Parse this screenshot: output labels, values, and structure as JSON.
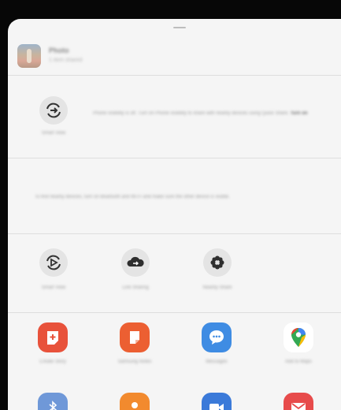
{
  "share_sheet": {
    "header": {
      "title": "Photo",
      "subtitle": "1 item shared"
    },
    "smart_view": {
      "label": "Smart View",
      "description": "Phone visibility is off. Turn on Phone visibility to share with nearby devices using Quick Share.",
      "link": "Turn on"
    },
    "nearby_note": "To find nearby devices, turn on Bluetooth and Wi-Fi and make sure the other device is visible.",
    "quick_actions": [
      {
        "label": "Smart View",
        "icon": "cast-icon"
      },
      {
        "label": "Link Sharing",
        "icon": "cloud-share-icon"
      },
      {
        "label": "Nearby Share",
        "icon": "nearby-share-icon"
      }
    ],
    "apps": [
      {
        "label": "Create Story",
        "icon": "create-story-icon",
        "color": "#e8523b"
      },
      {
        "label": "Samsung Notes",
        "icon": "samsung-notes-icon",
        "color": "#ec5f32"
      },
      {
        "label": "Messages",
        "icon": "messages-icon",
        "color": "#3f8ce3"
      },
      {
        "label": "Add to Maps",
        "icon": "maps-icon",
        "color": "#ffffff"
      }
    ],
    "bottom_apps": [
      {
        "icon": "bluetooth-icon",
        "color": "#6f98d8"
      },
      {
        "icon": "contacts-icon",
        "color": "#f28a2e"
      },
      {
        "icon": "video-call-icon",
        "color": "#3b7ad9"
      },
      {
        "icon": "email-icon",
        "color": "#e74b4b"
      }
    ]
  }
}
